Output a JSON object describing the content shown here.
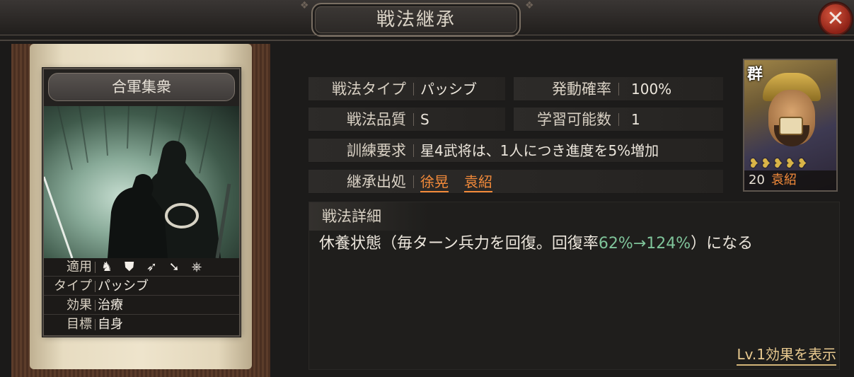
{
  "window": {
    "title": "戦法継承"
  },
  "tactic_card": {
    "name": "合軍集衆",
    "rows": [
      {
        "key": "適用",
        "icons": [
          "cavalry-icon",
          "shield-icon",
          "bow-icon",
          "spear-icon",
          "wheel-icon"
        ]
      },
      {
        "key": "タイプ",
        "value": "パッシブ"
      },
      {
        "key": "効果",
        "value": "治療"
      },
      {
        "key": "目標",
        "value": "自身"
      }
    ]
  },
  "fields": {
    "type": {
      "label": "戦法タイプ",
      "value": "パッシブ"
    },
    "rate": {
      "label": "発動確率",
      "value": "100%"
    },
    "quality": {
      "label": "戦法品質",
      "value": "S"
    },
    "learnable": {
      "label": "学習可能数",
      "value": "1"
    },
    "training": {
      "label": "訓練要求",
      "value": "星4武将は、1人につき進度を5%増加"
    },
    "source": {
      "label": "継承出処",
      "generals": [
        "徐晃",
        "袁紹"
      ]
    }
  },
  "detail": {
    "title": "戦法詳細",
    "text_before": "休養状態（毎ターン兵力を回復。回復率",
    "highlight": "62%→124%",
    "text_after": "）になる",
    "level_button": "Lv.1効果を表示"
  },
  "general": {
    "faction": "群",
    "level": "20",
    "name": "袁紹",
    "stars": 5
  },
  "colors": {
    "accent_orange": "#f28a3a",
    "highlight_green": "#7fc49a",
    "close_red": "#b23a28"
  }
}
